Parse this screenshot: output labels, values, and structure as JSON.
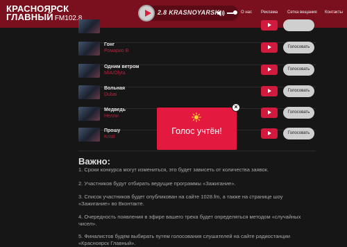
{
  "header": {
    "logo_line1": "КРАСНОЯРСК",
    "logo_line2": "ГЛАВНЫЙ",
    "logo_freq": "FM102.8",
    "player": {
      "station": "2.8 KRASNOYARSK"
    },
    "nav": [
      "О нас",
      "Реклама",
      "Сетка вещания",
      "Контакты"
    ]
  },
  "tracks": [
    {
      "title": "",
      "artist": "",
      "vote_label": ""
    },
    {
      "title": "Гонг",
      "artist": "Ромарио В",
      "vote_label": "Голосовать"
    },
    {
      "title": "Одним ветром",
      "artist": "MIA/Olyta",
      "vote_label": "Голосовать"
    },
    {
      "title": "Вольная",
      "artist": "Dubai",
      "vote_label": "Голосовать"
    },
    {
      "title": "Медведь",
      "artist": "Нелли",
      "vote_label": "Голосовать"
    },
    {
      "title": "Прошу",
      "artist": "Kristi",
      "vote_label": "Голосовать"
    }
  ],
  "important": {
    "title": "Важно:",
    "paragraphs": [
      "1. Сроки конкурса могут измениться, это будет зависеть от количества заявок.",
      "2. Участников будут отбирать ведущие программы «Зажигание».",
      "3. Список участников будет опубликован на сайте 1028.fm, а также на странице шоу «Зажигание» во Вконтакте.",
      "4. Очередность появления в эфире вашего трека будет определяться методом «случайных чисел».",
      "5. Финалистов будем выбирать путем голосования слушателей на сайте радиостанции «Красноярск Главный»."
    ]
  },
  "modal": {
    "message": "Голос учтён!",
    "icon": "sun-icon"
  },
  "colors": {
    "header": "#7a0f1e",
    "accent": "#e3193f",
    "background": "#161616"
  }
}
